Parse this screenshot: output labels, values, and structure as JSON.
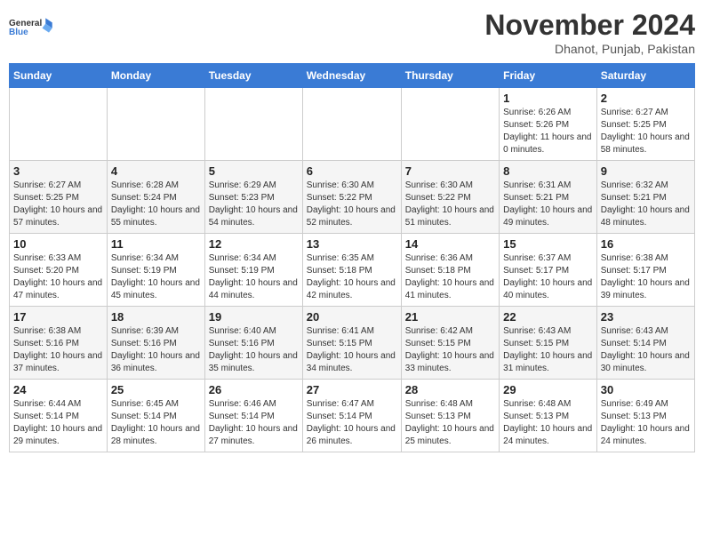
{
  "logo": {
    "line1": "General",
    "line2": "Blue"
  },
  "title": {
    "month": "November 2024",
    "location": "Dhanot, Punjab, Pakistan"
  },
  "weekdays": [
    "Sunday",
    "Monday",
    "Tuesday",
    "Wednesday",
    "Thursday",
    "Friday",
    "Saturday"
  ],
  "weeks": [
    [
      {
        "day": "",
        "sunrise": "",
        "sunset": "",
        "daylight": ""
      },
      {
        "day": "",
        "sunrise": "",
        "sunset": "",
        "daylight": ""
      },
      {
        "day": "",
        "sunrise": "",
        "sunset": "",
        "daylight": ""
      },
      {
        "day": "",
        "sunrise": "",
        "sunset": "",
        "daylight": ""
      },
      {
        "day": "",
        "sunrise": "",
        "sunset": "",
        "daylight": ""
      },
      {
        "day": "1",
        "sunrise": "Sunrise: 6:26 AM",
        "sunset": "Sunset: 5:26 PM",
        "daylight": "Daylight: 11 hours and 0 minutes."
      },
      {
        "day": "2",
        "sunrise": "Sunrise: 6:27 AM",
        "sunset": "Sunset: 5:25 PM",
        "daylight": "Daylight: 10 hours and 58 minutes."
      }
    ],
    [
      {
        "day": "3",
        "sunrise": "Sunrise: 6:27 AM",
        "sunset": "Sunset: 5:25 PM",
        "daylight": "Daylight: 10 hours and 57 minutes."
      },
      {
        "day": "4",
        "sunrise": "Sunrise: 6:28 AM",
        "sunset": "Sunset: 5:24 PM",
        "daylight": "Daylight: 10 hours and 55 minutes."
      },
      {
        "day": "5",
        "sunrise": "Sunrise: 6:29 AM",
        "sunset": "Sunset: 5:23 PM",
        "daylight": "Daylight: 10 hours and 54 minutes."
      },
      {
        "day": "6",
        "sunrise": "Sunrise: 6:30 AM",
        "sunset": "Sunset: 5:22 PM",
        "daylight": "Daylight: 10 hours and 52 minutes."
      },
      {
        "day": "7",
        "sunrise": "Sunrise: 6:30 AM",
        "sunset": "Sunset: 5:22 PM",
        "daylight": "Daylight: 10 hours and 51 minutes."
      },
      {
        "day": "8",
        "sunrise": "Sunrise: 6:31 AM",
        "sunset": "Sunset: 5:21 PM",
        "daylight": "Daylight: 10 hours and 49 minutes."
      },
      {
        "day": "9",
        "sunrise": "Sunrise: 6:32 AM",
        "sunset": "Sunset: 5:21 PM",
        "daylight": "Daylight: 10 hours and 48 minutes."
      }
    ],
    [
      {
        "day": "10",
        "sunrise": "Sunrise: 6:33 AM",
        "sunset": "Sunset: 5:20 PM",
        "daylight": "Daylight: 10 hours and 47 minutes."
      },
      {
        "day": "11",
        "sunrise": "Sunrise: 6:34 AM",
        "sunset": "Sunset: 5:19 PM",
        "daylight": "Daylight: 10 hours and 45 minutes."
      },
      {
        "day": "12",
        "sunrise": "Sunrise: 6:34 AM",
        "sunset": "Sunset: 5:19 PM",
        "daylight": "Daylight: 10 hours and 44 minutes."
      },
      {
        "day": "13",
        "sunrise": "Sunrise: 6:35 AM",
        "sunset": "Sunset: 5:18 PM",
        "daylight": "Daylight: 10 hours and 42 minutes."
      },
      {
        "day": "14",
        "sunrise": "Sunrise: 6:36 AM",
        "sunset": "Sunset: 5:18 PM",
        "daylight": "Daylight: 10 hours and 41 minutes."
      },
      {
        "day": "15",
        "sunrise": "Sunrise: 6:37 AM",
        "sunset": "Sunset: 5:17 PM",
        "daylight": "Daylight: 10 hours and 40 minutes."
      },
      {
        "day": "16",
        "sunrise": "Sunrise: 6:38 AM",
        "sunset": "Sunset: 5:17 PM",
        "daylight": "Daylight: 10 hours and 39 minutes."
      }
    ],
    [
      {
        "day": "17",
        "sunrise": "Sunrise: 6:38 AM",
        "sunset": "Sunset: 5:16 PM",
        "daylight": "Daylight: 10 hours and 37 minutes."
      },
      {
        "day": "18",
        "sunrise": "Sunrise: 6:39 AM",
        "sunset": "Sunset: 5:16 PM",
        "daylight": "Daylight: 10 hours and 36 minutes."
      },
      {
        "day": "19",
        "sunrise": "Sunrise: 6:40 AM",
        "sunset": "Sunset: 5:16 PM",
        "daylight": "Daylight: 10 hours and 35 minutes."
      },
      {
        "day": "20",
        "sunrise": "Sunrise: 6:41 AM",
        "sunset": "Sunset: 5:15 PM",
        "daylight": "Daylight: 10 hours and 34 minutes."
      },
      {
        "day": "21",
        "sunrise": "Sunrise: 6:42 AM",
        "sunset": "Sunset: 5:15 PM",
        "daylight": "Daylight: 10 hours and 33 minutes."
      },
      {
        "day": "22",
        "sunrise": "Sunrise: 6:43 AM",
        "sunset": "Sunset: 5:15 PM",
        "daylight": "Daylight: 10 hours and 31 minutes."
      },
      {
        "day": "23",
        "sunrise": "Sunrise: 6:43 AM",
        "sunset": "Sunset: 5:14 PM",
        "daylight": "Daylight: 10 hours and 30 minutes."
      }
    ],
    [
      {
        "day": "24",
        "sunrise": "Sunrise: 6:44 AM",
        "sunset": "Sunset: 5:14 PM",
        "daylight": "Daylight: 10 hours and 29 minutes."
      },
      {
        "day": "25",
        "sunrise": "Sunrise: 6:45 AM",
        "sunset": "Sunset: 5:14 PM",
        "daylight": "Daylight: 10 hours and 28 minutes."
      },
      {
        "day": "26",
        "sunrise": "Sunrise: 6:46 AM",
        "sunset": "Sunset: 5:14 PM",
        "daylight": "Daylight: 10 hours and 27 minutes."
      },
      {
        "day": "27",
        "sunrise": "Sunrise: 6:47 AM",
        "sunset": "Sunset: 5:14 PM",
        "daylight": "Daylight: 10 hours and 26 minutes."
      },
      {
        "day": "28",
        "sunrise": "Sunrise: 6:48 AM",
        "sunset": "Sunset: 5:13 PM",
        "daylight": "Daylight: 10 hours and 25 minutes."
      },
      {
        "day": "29",
        "sunrise": "Sunrise: 6:48 AM",
        "sunset": "Sunset: 5:13 PM",
        "daylight": "Daylight: 10 hours and 24 minutes."
      },
      {
        "day": "30",
        "sunrise": "Sunrise: 6:49 AM",
        "sunset": "Sunset: 5:13 PM",
        "daylight": "Daylight: 10 hours and 24 minutes."
      }
    ]
  ]
}
